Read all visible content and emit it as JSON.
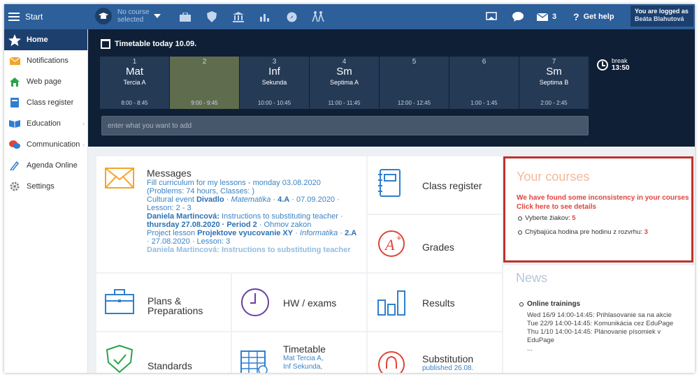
{
  "topbar": {
    "start_label": "Start",
    "course_selector": "No course selected",
    "mail_count": "3",
    "get_help": "Get help",
    "logged_as_label": "You are logged as",
    "logged_as_name": "Beáta Blahutová"
  },
  "sidebar": {
    "items": [
      {
        "label": "Home",
        "icon": "star-icon"
      },
      {
        "label": "Notifications",
        "icon": "envelope-icon"
      },
      {
        "label": "Web page",
        "icon": "house-icon"
      },
      {
        "label": "Class register",
        "icon": "book-icon"
      },
      {
        "label": "Education",
        "icon": "open-book-icon"
      },
      {
        "label": "Communication",
        "icon": "chat-icon"
      },
      {
        "label": "Agenda Online",
        "icon": "pencil-icon"
      },
      {
        "label": "Settings",
        "icon": "gear-icon"
      }
    ]
  },
  "timetable": {
    "title": "Timetable today 10.09.",
    "slots": [
      {
        "num": "1",
        "subject": "Mat",
        "class": "Tercia A",
        "time": "8:00 - 8:45"
      },
      {
        "num": "2",
        "subject": "",
        "class": "",
        "time": "9:00 - 9:45"
      },
      {
        "num": "3",
        "subject": "Inf",
        "class": "Sekunda",
        "time": "10:00 - 10:45"
      },
      {
        "num": "4",
        "subject": "Sm",
        "class": "Septima A",
        "time": "11:00 - 11:45"
      },
      {
        "num": "5",
        "subject": "",
        "class": "",
        "time": "12:00 - 12:45"
      },
      {
        "num": "6",
        "subject": "",
        "class": "",
        "time": "1:00 - 1:45"
      },
      {
        "num": "7",
        "subject": "Sm",
        "class": "Septima B",
        "time": "2:00 - 2:45"
      }
    ],
    "break_label": "break",
    "break_time": "13:50",
    "add_placeholder": "enter what you want to add"
  },
  "messages": {
    "title": "Messages",
    "lines": [
      "Fill curriculum for my lessons - monday 03.08.2020",
      "(Problems: 74 hours, Classes: )"
    ],
    "event_prefix": "Cultural event ",
    "event_name": "Divadlo",
    "event_sep1": " · ",
    "event_subject": "Matematika",
    "event_sep2": " · ",
    "event_class": "4.A",
    "event_date": " · 07.09.2020 ·",
    "event_lesson": "Lesson: 2 - 3",
    "msg2_author": "Daniela Martincová:",
    "msg2_text": " Instructions to substituting teacher ·",
    "msg2_date": "thursday 27.08.2020 · Period 2",
    "msg2_subject": " · Ohmov zakon",
    "msg3_prefix": "Project lesson ",
    "msg3_name": "Projektove vyucovanie XY",
    "msg3_sep": " · ",
    "msg3_subject": "Informatika",
    "msg3_sep2": " · ",
    "msg3_class": "2.A",
    "msg3_date": "· 27.08.2020 · Lesson: 3",
    "msg4_cut": "Daniela Martincová: Instructions to substituting teacher"
  },
  "tiles": {
    "class_register": "Class register",
    "grades": "Grades",
    "plans": "Plans & Preparations",
    "hw_exams": "HW / exams",
    "results": "Results",
    "standards": "Standards",
    "timetable_label": "Timetable",
    "timetable_sub1": "Mat Tercia A,",
    "timetable_sub2": "Inf Sekunda,",
    "substitution": "Substitution",
    "substitution_sub": "published 26.08."
  },
  "courses": {
    "title": "Your courses",
    "warning_line1": "We have found some inconsistency in your courses",
    "warning_line2": "Click here to see details",
    "items": [
      {
        "label": "Vyberte žiakov: ",
        "count": "5"
      },
      {
        "label": "Chýbajúca hodina pre hodinu z rozvrhu: ",
        "count": "3"
      }
    ],
    "accent_color": "#c0322b"
  },
  "news": {
    "title": "News",
    "section": "Online trainings",
    "lines": [
      "Wed 16/9 14:00-14:45: Prihlasovanie sa na akcie",
      "Tue 22/9 14:00-14:45: Komunikácia cez EduPage",
      "Thu 1/10 14:00-14:45: Plánovanie písomiek v EduPage",
      "..."
    ]
  }
}
